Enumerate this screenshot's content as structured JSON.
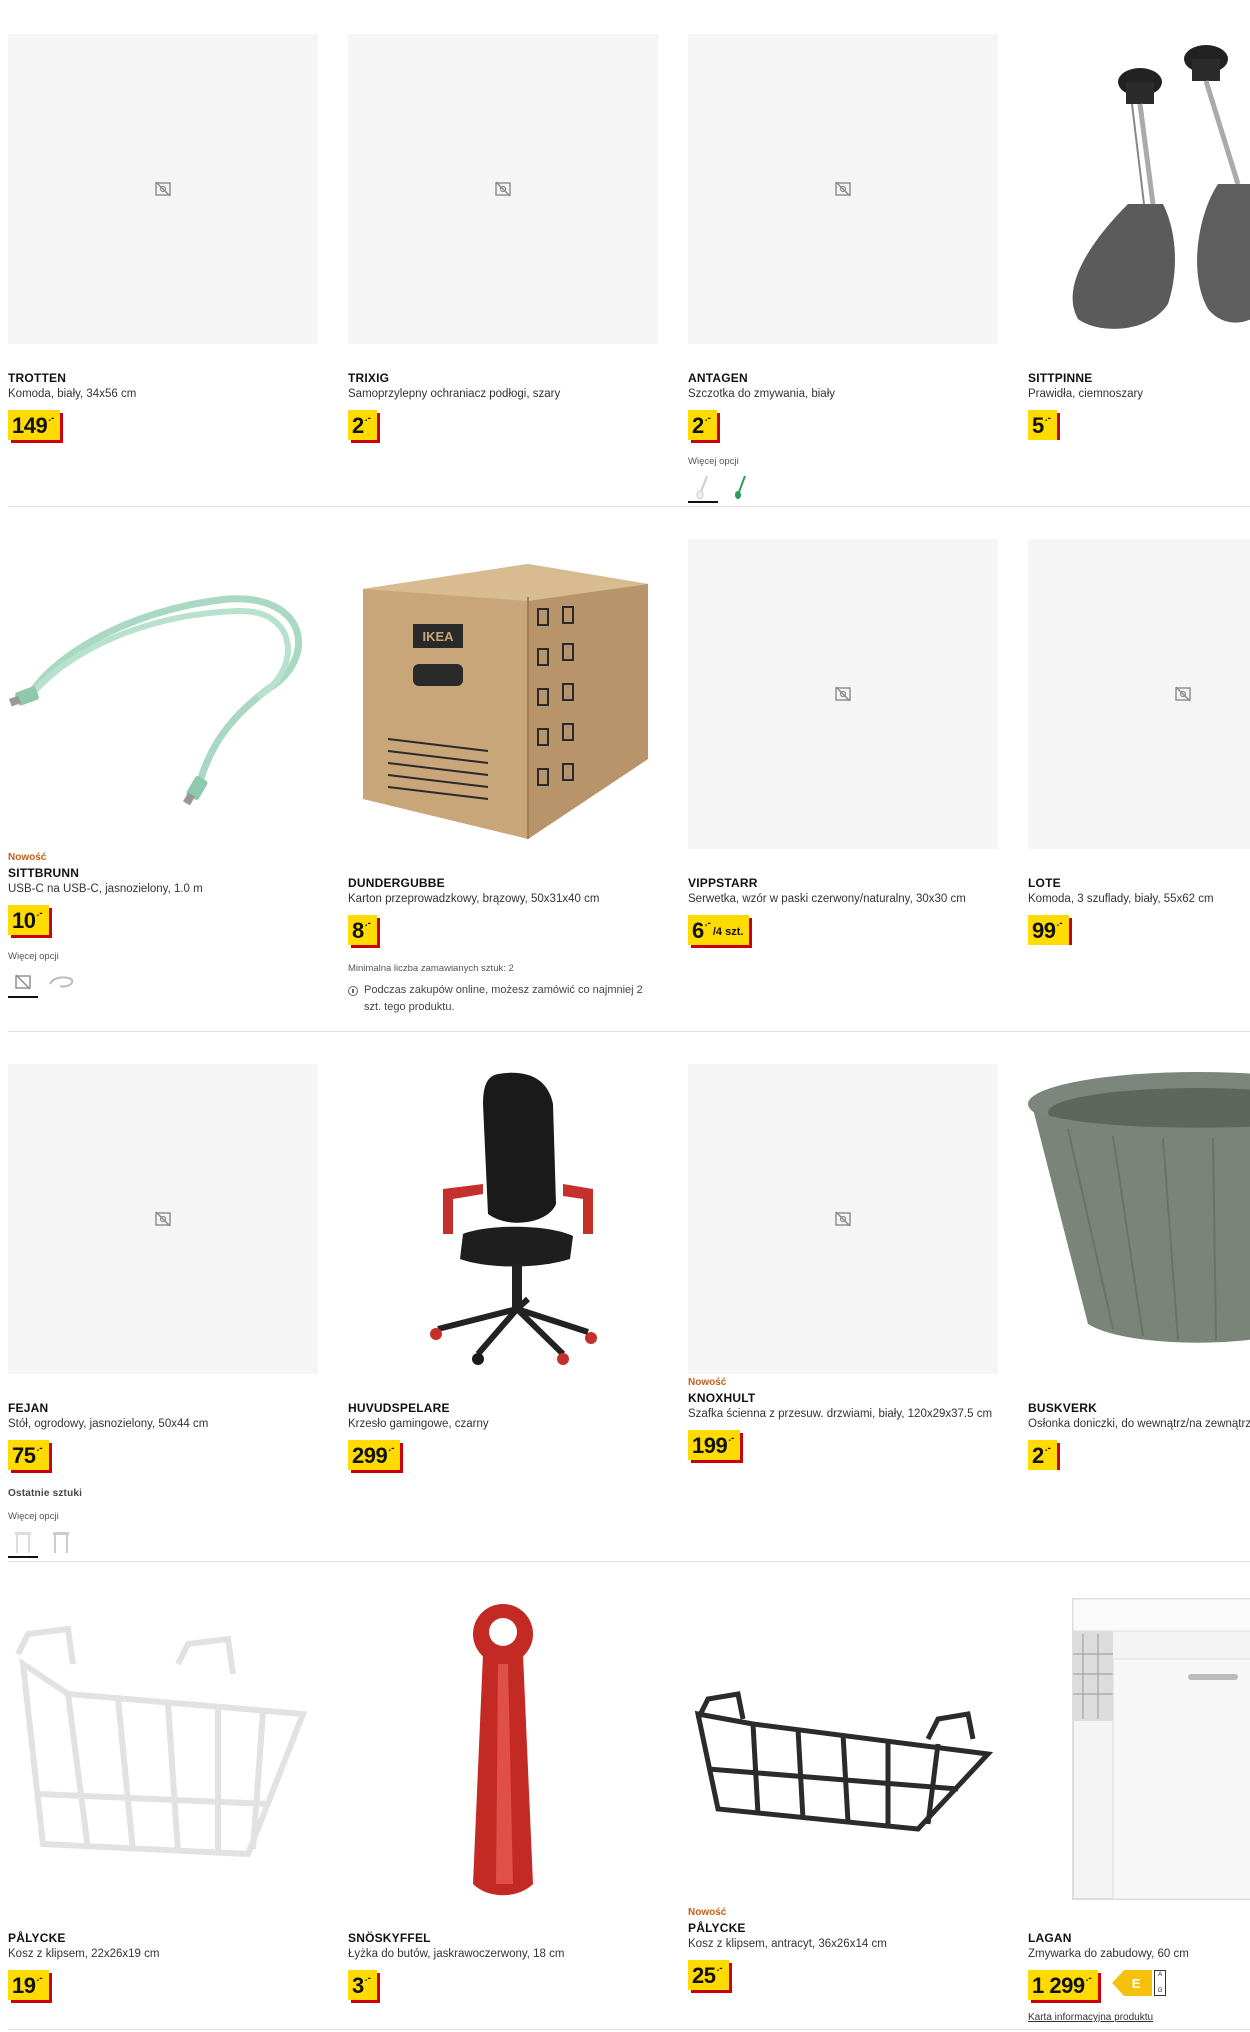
{
  "labels": {
    "new": "Nowość",
    "more_options": "Więcej opcji",
    "last_items": "Ostatnie sztuki"
  },
  "products": [
    {
      "name": "TROTTEN",
      "desc": "Komoda, biały, 34x56 cm",
      "price": "149",
      "currency": ".-",
      "image": "no-image-icon"
    },
    {
      "name": "TRIXIG",
      "desc": "Samoprzylepny ochraniacz podłogi, szary",
      "price": "2",
      "currency": ".-",
      "image": "no-image-icon"
    },
    {
      "name": "ANTAGEN",
      "desc": "Szczotka do zmywania, biały",
      "price": "2",
      "currency": ".-",
      "image": "no-image-icon"
    },
    {
      "name": "SITTPINNE",
      "desc": "Prawidła, ciemnoszary",
      "price": "5",
      "currency": ".-",
      "image": "shoe-trees-photo"
    },
    {
      "name": "SITTBRUNN",
      "desc": "USB-C na USB-C, jasnozielony, 1.0 m",
      "price": "10",
      "currency": ".-",
      "image": "usb-cable-photo"
    },
    {
      "name": "DUNDERGUBBE",
      "desc": "Karton przeprowadzkowy, brązowy, 50x31x40 cm",
      "price": "8",
      "currency": ".-",
      "image": "moving-box-photo",
      "min_qty": "Minimalna liczba zamawianych sztuk: 2",
      "note": "Podczas zakupów online, możesz zamówić co najmniej 2 szt. tego produktu."
    },
    {
      "name": "VIPPSTARR",
      "desc": "Serwetka, wzór w paski czerwony/naturalny, 30x30 cm",
      "price": "6",
      "currency": ".-",
      "unit": "/4 szt.",
      "image": "no-image-icon"
    },
    {
      "name": "LOTE",
      "desc": "Komoda, 3 szuflady, biały, 55x62 cm",
      "price": "99",
      "currency": ".-",
      "image": "no-image-icon"
    },
    {
      "name": "FEJAN",
      "desc": "Stół, ogrodowy, jasnozielony, 50x44 cm",
      "price": "75",
      "currency": ".-",
      "image": "no-image-icon"
    },
    {
      "name": "HUVUDSPELARE",
      "desc": "Krzesło gamingowe, czarny",
      "price": "299",
      "currency": ".-",
      "image": "gaming-chair-photo"
    },
    {
      "name": "KNOXHULT",
      "desc": "Szafka ścienna z przesuw. drzwiami, biały, 120x29x37.5 cm",
      "price": "199",
      "currency": ".-",
      "image": "no-image-icon"
    },
    {
      "name": "BUSKVERK",
      "desc": "Osłonka doniczki, do wewnątrz/na zewnątrz",
      "price": "2",
      "currency": ".-",
      "image": "plant-pot-photo"
    },
    {
      "name": "PÅLYCKE",
      "desc": "Kosz z klipsem, 22x26x19 cm",
      "price": "19",
      "currency": ".-",
      "image": "white-basket-photo"
    },
    {
      "name": "SNÖSKYFFEL",
      "desc": "Łyżka do butów, jaskrawoczerwony, 18 cm",
      "price": "3",
      "currency": ".-",
      "image": "shoehorn-photo"
    },
    {
      "name": "PÅLYCKE",
      "desc": "Kosz z klipsem, antracyt, 36x26x14 cm",
      "price": "25",
      "currency": ".-",
      "image": "black-basket-photo"
    },
    {
      "name": "LAGAN",
      "desc": "Zmywarka do zabudowy, 60 cm",
      "price": "1 299",
      "currency": ".-",
      "image": "dishwasher-photo",
      "energy_class": "E",
      "energy_scale_top": "A",
      "energy_scale_bottom": "G",
      "info_link": "Karta informacyjna produktu"
    }
  ],
  "colors": {
    "price_bg": "#ffdb00",
    "price_shadow": "#cc0008",
    "new_text": "#c45f1a",
    "placeholder_bg": "#f5f5f5",
    "energy": "#f5c10c"
  }
}
